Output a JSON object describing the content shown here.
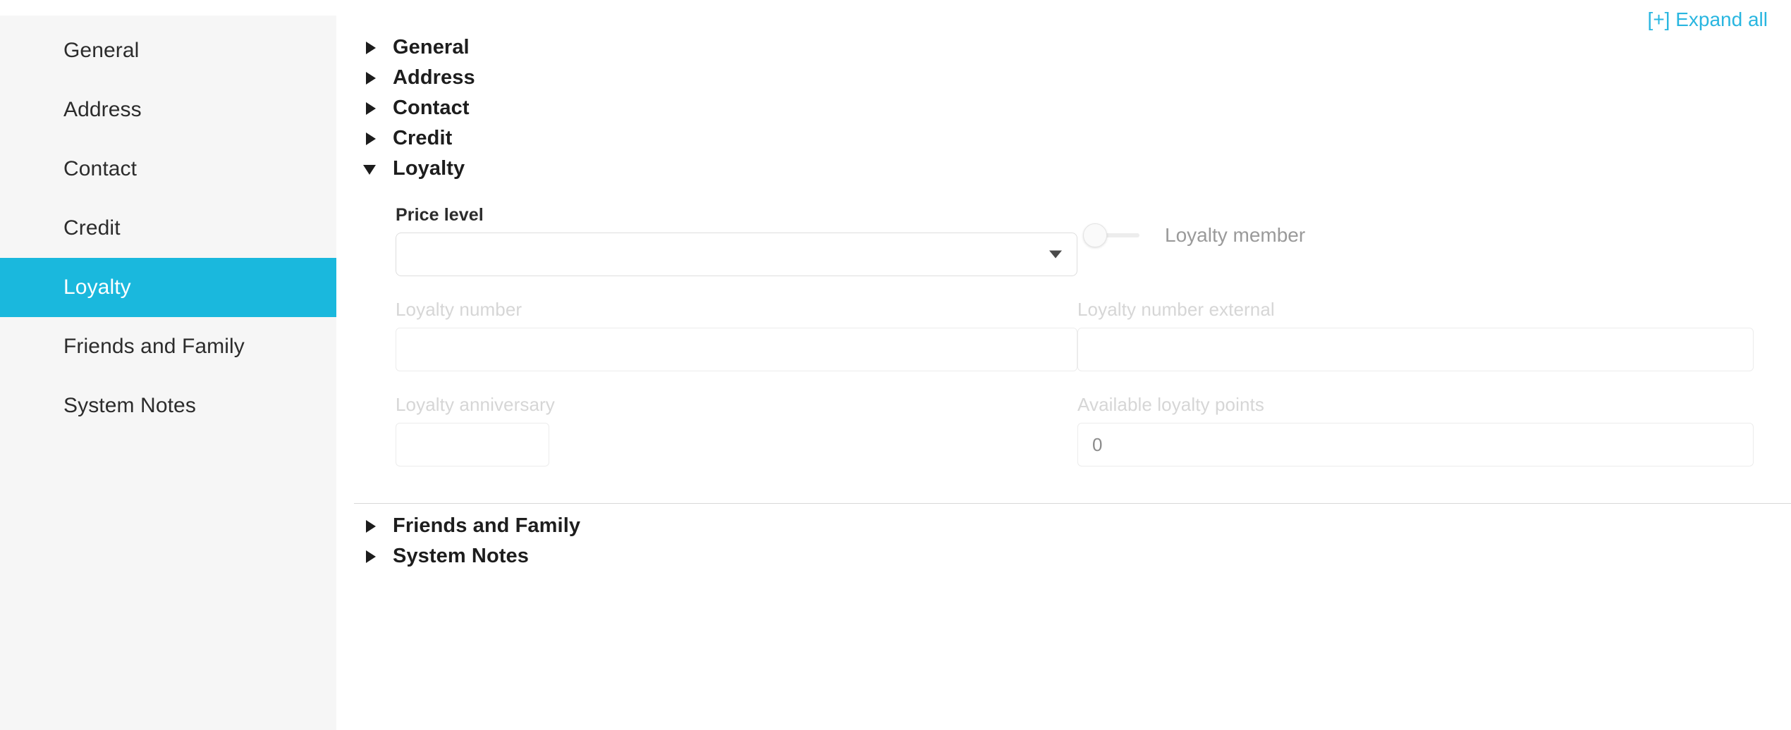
{
  "sidebar": {
    "items": [
      {
        "label": "General",
        "active": false
      },
      {
        "label": "Address",
        "active": false
      },
      {
        "label": "Contact",
        "active": false
      },
      {
        "label": "Credit",
        "active": false
      },
      {
        "label": "Loyalty",
        "active": true
      },
      {
        "label": "Friends and Family",
        "active": false
      },
      {
        "label": "System Notes",
        "active": false
      }
    ]
  },
  "toolbar": {
    "expand_all_label": "[+] Expand all"
  },
  "colors": {
    "accent": "#1ab8dd",
    "link": "#29b6e0",
    "sidebar_bg": "#f6f6f6",
    "muted_text": "#d6d6d6"
  },
  "sections": [
    {
      "title": "General",
      "expanded": false,
      "caret_icon": "caret-right-icon"
    },
    {
      "title": "Address",
      "expanded": false,
      "caret_icon": "caret-right-icon"
    },
    {
      "title": "Contact",
      "expanded": false,
      "caret_icon": "caret-right-icon"
    },
    {
      "title": "Credit",
      "expanded": false,
      "caret_icon": "caret-right-icon"
    },
    {
      "title": "Loyalty",
      "expanded": true,
      "caret_icon": "caret-down-icon"
    },
    {
      "title": "Friends and Family",
      "expanded": false,
      "caret_icon": "caret-right-icon"
    },
    {
      "title": "System Notes",
      "expanded": false,
      "caret_icon": "caret-right-icon"
    }
  ],
  "loyalty": {
    "price_level": {
      "label": "Price level",
      "value": "",
      "placeholder": "",
      "dropdown_icon": "chevron-down-icon"
    },
    "loyalty_member": {
      "label": "Loyalty member",
      "checked": false
    },
    "loyalty_number": {
      "label": "Loyalty number",
      "value": "",
      "placeholder": "",
      "disabled": true
    },
    "loyalty_number_external": {
      "label": "Loyalty number external",
      "value": "",
      "placeholder": "",
      "disabled": true
    },
    "loyalty_anniversary": {
      "label": "Loyalty anniversary",
      "value": "",
      "placeholder": "",
      "disabled": true
    },
    "available_loyalty_points": {
      "label": "Available loyalty points",
      "value": "0",
      "placeholder": "",
      "disabled": true
    }
  }
}
